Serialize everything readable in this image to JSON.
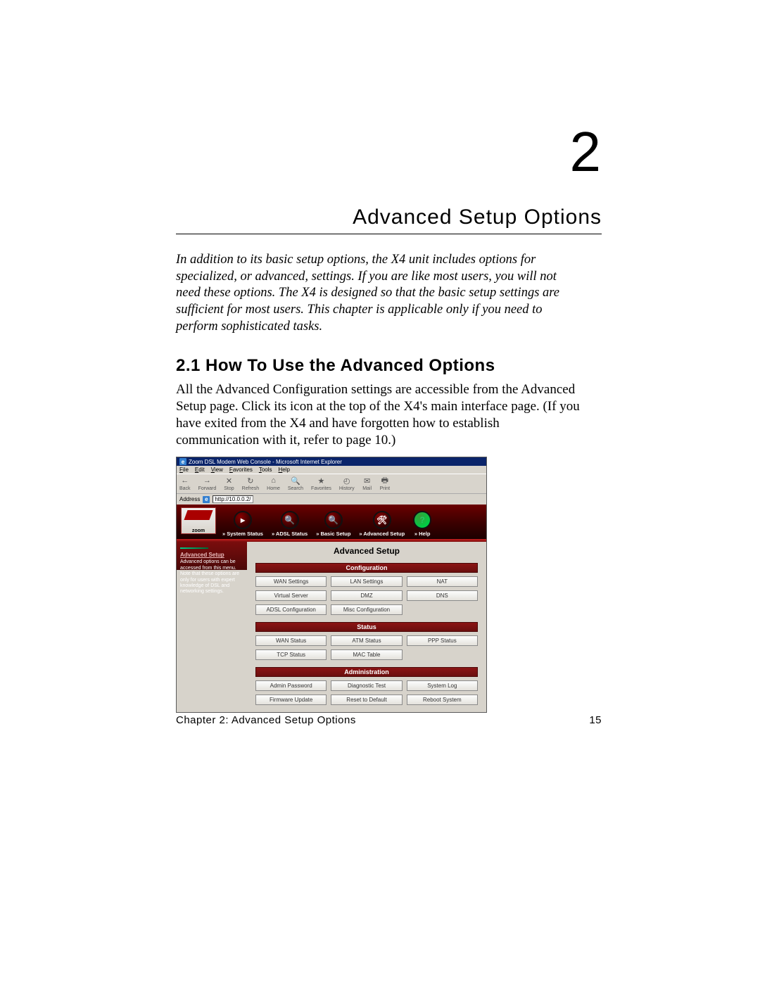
{
  "chapter_number": "2",
  "chapter_title": "Advanced Setup Options",
  "intro": "In addition to its basic setup options, the X4 unit includes options for specialized, or advanced, settings. If you are like most users, you will not need these options. The X4 is designed so that the basic setup settings are sufficient for most users. This chapter is applicable only if you need to perform sophisticated tasks.",
  "section_title": "2.1 How To Use the Advanced Options",
  "body": "All the Advanced Configuration settings are accessible from the Advanced Setup page. Click its icon at the top of the X4's main interface page. (If you have exited from the X4 and have forgotten how to establish communication with it, refer to page 10.)",
  "footer_left": "Chapter 2: Advanced Setup Options",
  "footer_right": "15",
  "screenshot": {
    "window_title": "Zoom DSL Modem Web Console - Microsoft Internet Explorer",
    "menu": [
      "File",
      "Edit",
      "View",
      "Favorites",
      "Tools",
      "Help"
    ],
    "toolbar": [
      {
        "icon": "←",
        "label": "Back"
      },
      {
        "icon": "→",
        "label": "Forward"
      },
      {
        "icon": "✕",
        "label": "Stop"
      },
      {
        "icon": "↻",
        "label": "Refresh"
      },
      {
        "icon": "⌂",
        "label": "Home"
      },
      {
        "icon": "🔍",
        "label": "Search"
      },
      {
        "icon": "★",
        "label": "Favorites"
      },
      {
        "icon": "◴",
        "label": "History"
      },
      {
        "icon": "✉",
        "label": "Mail"
      },
      {
        "icon": "🖶",
        "label": "Print"
      }
    ],
    "address_label": "Address",
    "address_value": "http://10.0.0.2/",
    "logo_text": "zoom",
    "nav": [
      {
        "icon": "▸",
        "label": "» System Status"
      },
      {
        "icon": "🔍",
        "label": "» ADSL Status"
      },
      {
        "icon": "🔍",
        "label": "» Basic Setup"
      },
      {
        "icon": "🛠",
        "label": "» Advanced Setup"
      },
      {
        "icon": "?",
        "label": "» Help",
        "help": true
      }
    ],
    "sidebar_title": "Advanced Setup",
    "sidebar_text": "Advanced options can be accessed from this menu. Note that these options are only for users with expert knowledge of DSL and networking settings.",
    "panel_title": "Advanced Setup",
    "groups": [
      {
        "title": "Configuration",
        "rows": [
          [
            "WAN Settings",
            "LAN Settings",
            "NAT"
          ],
          [
            "Virtual Server",
            "DMZ",
            "DNS"
          ],
          [
            "ADSL Configuration",
            "Misc Configuration",
            ""
          ]
        ]
      },
      {
        "title": "Status",
        "rows": [
          [
            "WAN Status",
            "ATM Status",
            "PPP Status"
          ],
          [
            "TCP Status",
            "MAC Table",
            ""
          ]
        ]
      },
      {
        "title": "Administration",
        "rows": [
          [
            "Admin Password",
            "Diagnostic Test",
            "System Log"
          ],
          [
            "Firmware Update",
            "Reset to Default",
            "Reboot System"
          ]
        ]
      }
    ]
  }
}
